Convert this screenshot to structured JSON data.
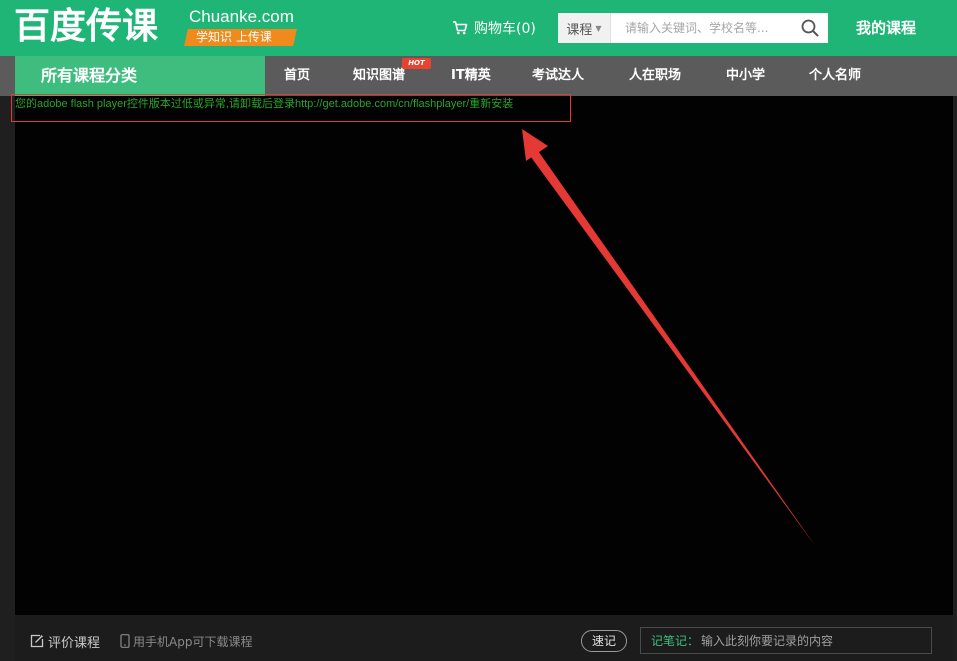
{
  "header": {
    "logo_main": "百度传课",
    "logo_domain": "Chuanke.com",
    "logo_slogan": "学知识 上传课",
    "cart_label": "购物车(0)",
    "search": {
      "type_label": "课程",
      "placeholder": "请输入关键词、学校名等..."
    },
    "my_courses_label": "我的课程"
  },
  "nav": {
    "all_categories": "所有课程分类",
    "items": [
      {
        "label": "首页"
      },
      {
        "label": "知识图谱",
        "badge": "HOT"
      },
      {
        "label": "IT精英"
      },
      {
        "label": "考试达人"
      },
      {
        "label": "人在职场"
      },
      {
        "label": "中小学"
      },
      {
        "label": "个人名师"
      }
    ]
  },
  "player": {
    "flash_message": "您的adobe flash player控件版本过低或异常,请卸载后登录http://get.adobe.com/cn/flashplayer/重新安装"
  },
  "bottom": {
    "rate_label": "评价课程",
    "mobile_label": "用手机App可下载课程",
    "quick_note_label": "速记",
    "note_label": "记笔记：",
    "note_placeholder": "输入此刻你要记录的内容"
  },
  "colors": {
    "brand_green": "#1fb577",
    "nav_gray": "#5b5b5b",
    "nav_green": "#3ebd7e",
    "slogan_orange": "#f08a1c",
    "annotation_red": "#e53935",
    "message_green": "#2aa52a"
  },
  "icons": {
    "cart": "cart-icon",
    "search": "search-icon",
    "rate": "edit-icon",
    "mobile": "phone-icon"
  }
}
